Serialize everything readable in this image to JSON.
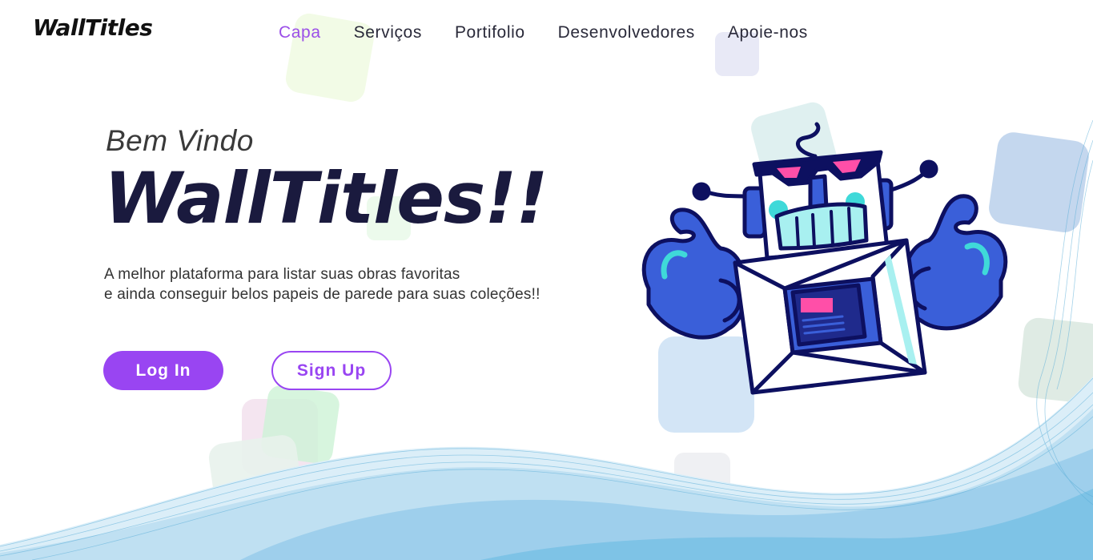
{
  "brand": {
    "logo_text": "WallTitles"
  },
  "nav": {
    "items": [
      {
        "label": "Capa",
        "active": true
      },
      {
        "label": "Serviços",
        "active": false
      },
      {
        "label": "Portifolio",
        "active": false
      },
      {
        "label": "Desenvolvedores",
        "active": false
      },
      {
        "label": "Apoie-nos",
        "active": false
      }
    ]
  },
  "hero": {
    "welcome": "Bem Vindo",
    "headline": "WallTitles!!",
    "tagline_line1": "A melhor plataforma para listar suas obras favoritas",
    "tagline_line2": "e ainda conseguir belos papeis de parede para suas coleções!!",
    "login_label": "Log In",
    "signup_label": "Sign Up"
  },
  "illustration": {
    "icon": "robot-thumbs-up-icon"
  },
  "colors": {
    "accent": "#9945f2",
    "nav_active": "#9b4fe8",
    "headline": "#1a1a3e",
    "robot_navy": "#0d1060",
    "robot_blue": "#3a5fd9",
    "robot_cyan": "#3fd9d9",
    "robot_pink": "#ff4fa8",
    "wave_blue": "#7ec3e6"
  }
}
